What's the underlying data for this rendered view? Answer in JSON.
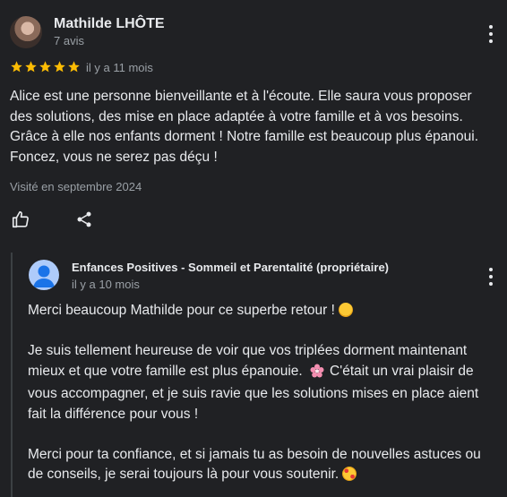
{
  "review": {
    "author": "Mathilde LHÔTE",
    "review_count": "7 avis",
    "rating": 5,
    "time": "il y a 11 mois",
    "lines": [
      "Alice est une personne bienveillante et à l'écoute. Elle saura vous proposer",
      "des solutions, des mise en place adaptée à votre famille et à vos besoins.",
      "Grâce à elle nos enfants dorment ! Notre famille est beaucoup plus épanoui.",
      "Foncez, vous ne serez pas déçu !"
    ],
    "visited": "Visité en septembre 2024",
    "star_color": "#fbbc04"
  },
  "reply": {
    "owner": "Enfances Positives - Sommeil et Parentalité (propriétaire)",
    "time": "il y a 10 mois",
    "para1": "Merci beaucoup Mathilde pour ce superbe retour !",
    "para2_lines": [
      "Je suis tellement heureuse de voir que vos triplées dorment maintenant",
      "mieux et que votre famille est plus épanouie.",
      "C'était un vrai plaisir de",
      "vous accompagner, et je suis ravie que les solutions mises en place aient",
      "fait la différence pour vous !"
    ],
    "para3_lines": [
      "Merci pour ta confiance, et si jamais tu as besoin de nouvelles astuces ou",
      "de conseils, je serai toujours là pour vous soutenir."
    ]
  }
}
